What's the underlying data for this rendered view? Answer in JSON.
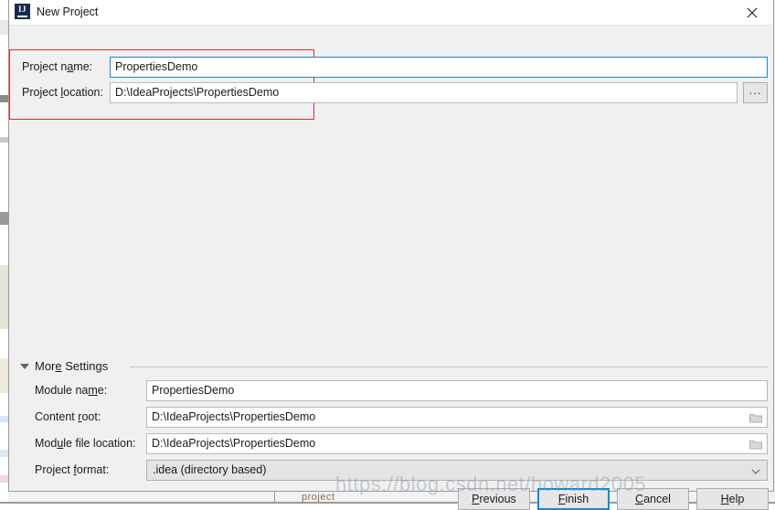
{
  "window": {
    "title": "New Project",
    "logo_text": "IJ",
    "close_label": "×"
  },
  "top_section": {
    "project_name": {
      "label_pre": "Project n",
      "label_mn": "a",
      "label_post": "me:",
      "value": "PropertiesDemo"
    },
    "project_location": {
      "label_pre": "Project ",
      "label_mn": "l",
      "label_post": "ocation:",
      "value": "D:\\IdeaProjects\\PropertiesDemo"
    },
    "browse_button_label": "..."
  },
  "more_settings": {
    "header_pre": "Mor",
    "header_mn": "e",
    "header_post": " Settings",
    "expanded": true,
    "fields": [
      {
        "label_pre": "Module na",
        "label_mn": "m",
        "label_post": "e:",
        "value": "PropertiesDemo",
        "has_folder_icon": false,
        "type": "text"
      },
      {
        "label_pre": "Content ",
        "label_mn": "r",
        "label_post": "oot:",
        "value": "D:\\IdeaProjects\\PropertiesDemo",
        "has_folder_icon": true,
        "type": "text"
      },
      {
        "label_pre": "Mod",
        "label_mn": "u",
        "label_post": "le file location:",
        "value": "D:\\IdeaProjects\\PropertiesDemo",
        "has_folder_icon": true,
        "type": "text"
      },
      {
        "label_pre": "Project ",
        "label_mn": "f",
        "label_post": "ormat:",
        "value": ".idea (directory based)",
        "has_folder_icon": false,
        "type": "combo"
      }
    ]
  },
  "buttons": [
    {
      "pre": "",
      "mn": "P",
      "post": "revious",
      "default": false
    },
    {
      "pre": "",
      "mn": "F",
      "post": "inish",
      "default": true
    },
    {
      "pre": "",
      "mn": "C",
      "post": "ancel",
      "default": false
    },
    {
      "pre": "",
      "mn": "H",
      "post": "elp",
      "default": false
    }
  ],
  "watermark": "https://blog.csdn.net/howard2005",
  "background": {
    "bottom_text": "project"
  },
  "colors": {
    "accent_blue": "#1a87d6",
    "annotation_red": "#e02b2b",
    "dialog_bg": "#f0f0f0",
    "titlebar_bg": "#ffffff"
  }
}
